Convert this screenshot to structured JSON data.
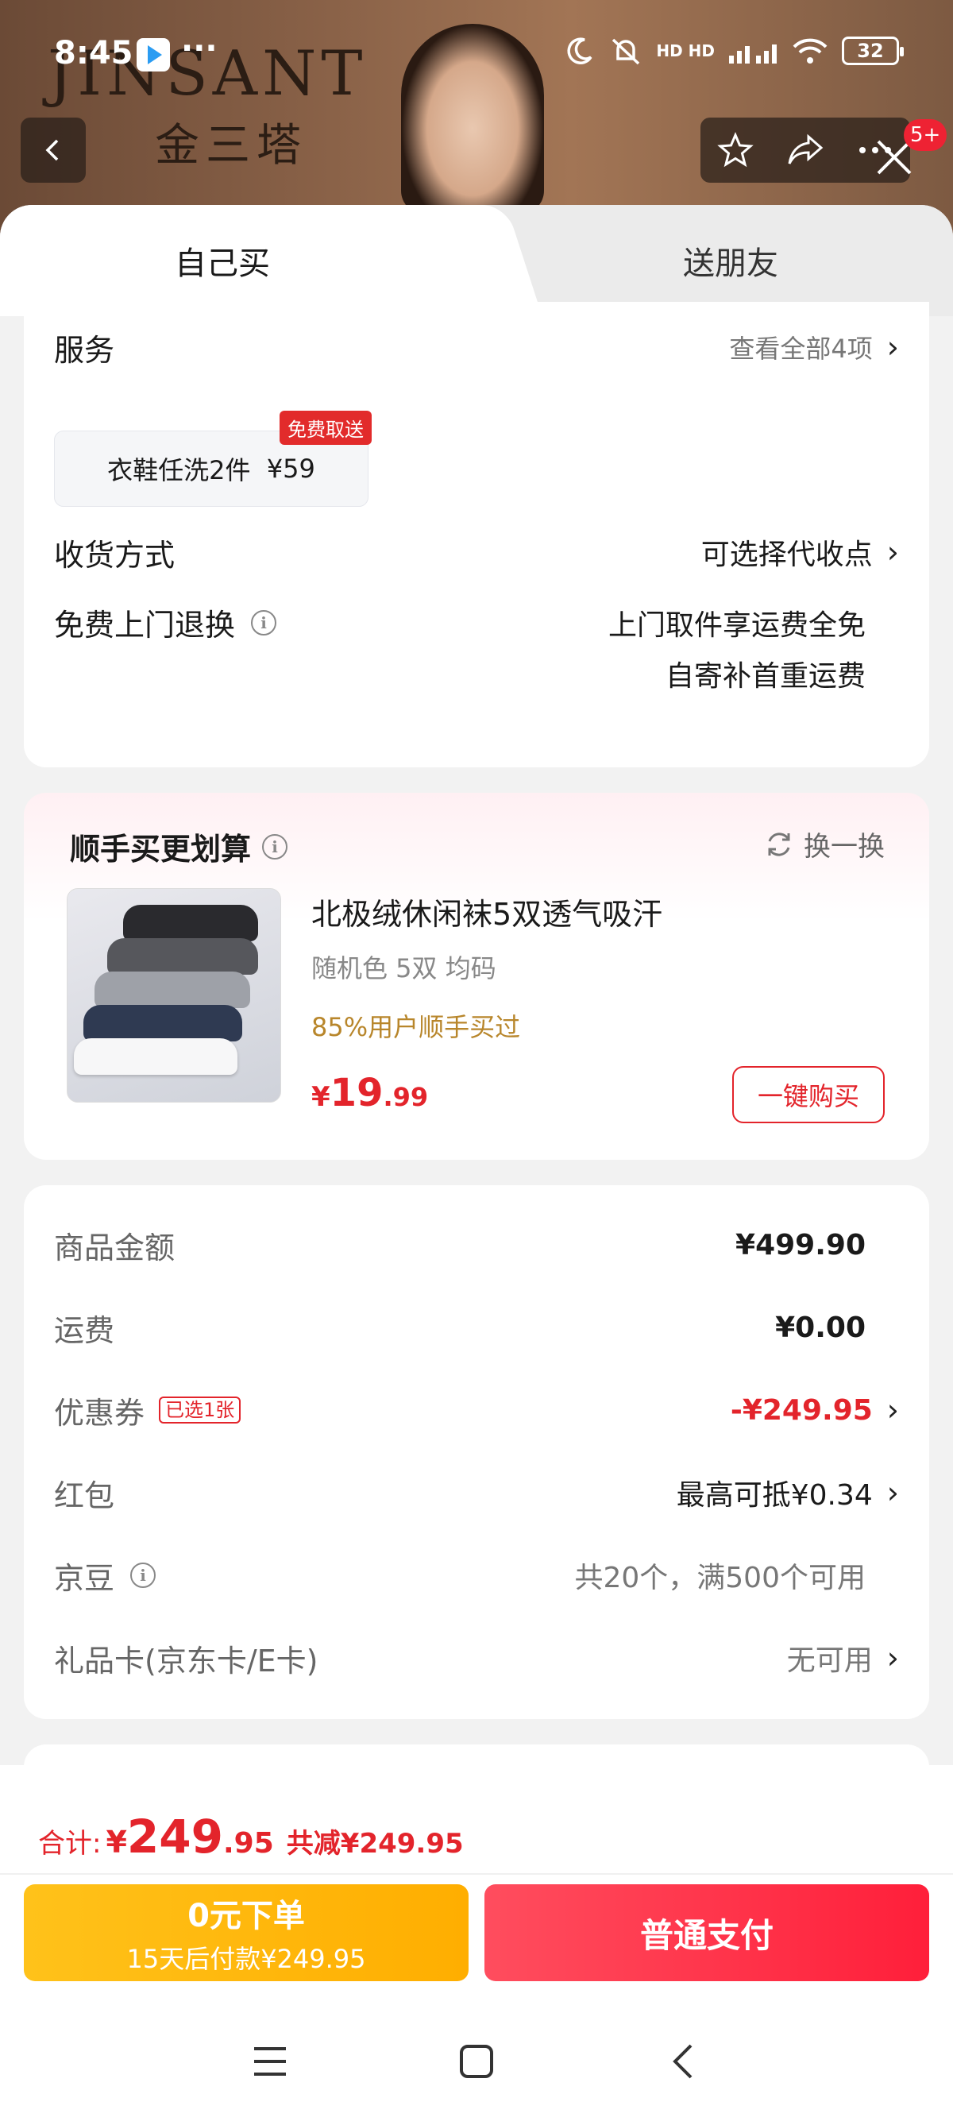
{
  "status_bar": {
    "time": "8:45",
    "dots": "···",
    "network": "HD HD",
    "battery": "32"
  },
  "brand": {
    "en": "JINSANT",
    "cn": "金三塔"
  },
  "top_nav": {
    "badge": "5+"
  },
  "tabs": {
    "self": "自己买",
    "friend": "送朋友"
  },
  "services": {
    "label": "服务",
    "view_all": "查看全部4项",
    "chip_label": "衣鞋任洗2件",
    "chip_price": "¥59",
    "chip_tag": "免费取送",
    "delivery_label": "收货方式",
    "delivery_value": "可选择代收点",
    "return_label": "免费上门退换",
    "return_line1": "上门取件享运费全免",
    "return_line2": "自寄补首重运费"
  },
  "addon": {
    "title": "顺手买更划算",
    "swap": "换一换",
    "product_name": "北极绒休闲袜5双透气吸汗",
    "product_spec": "随机色 5双    均码",
    "product_hint": "85%用户顺手买过",
    "price_symbol": "¥",
    "price_int": "19",
    "price_dec": ".99",
    "buy_label": "一键购买"
  },
  "summary": {
    "goods_label": "商品金额",
    "goods_value": "¥499.90",
    "shipping_label": "运费",
    "shipping_value": "¥0.00",
    "coupon_label": "优惠券",
    "coupon_tag": "已选1张",
    "coupon_value": "-¥249.95",
    "redpacket_label": "红包",
    "redpacket_value": "最高可抵¥0.34",
    "jingdou_label": "京豆",
    "jingdou_value": "共20个，满500个可用",
    "giftcard_label": "礼品卡(京东卡/E卡)",
    "giftcard_value": "无可用"
  },
  "bottom": {
    "total_label": "合计:",
    "total_symbol": "¥",
    "total_int": "249",
    "total_dec": ".95",
    "saved": "共减¥249.95",
    "later_line1": "0元下单",
    "later_line2": "15天后付款¥249.95",
    "pay_label": "普通支付"
  },
  "colors": {
    "accent_red": "#e3242b",
    "later_yellow": "#ffb800",
    "pay_red": "#ff2a44"
  }
}
